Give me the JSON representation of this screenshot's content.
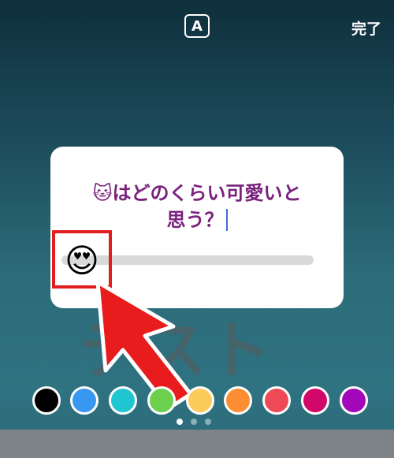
{
  "toolbar": {
    "font_button_label": "A",
    "done_label": "完了"
  },
  "card": {
    "question_line1": "🐱はどのくらい可愛いと",
    "question_line2": "思う？",
    "slider_emoji": "😍",
    "slider_level": 0
  },
  "background": {
    "text": "テスト"
  },
  "palette": {
    "colors": [
      "#000000",
      "#3897f0",
      "#1fc6d2",
      "#6ccf4e",
      "#fdcb5c",
      "#fd8d32",
      "#ed4956",
      "#d10869",
      "#a307ba"
    ]
  },
  "pager": {
    "count": 3,
    "active_index": 0
  },
  "accent_colors": {
    "question_text": "#7a207d",
    "annotation": "#e21d1d"
  }
}
